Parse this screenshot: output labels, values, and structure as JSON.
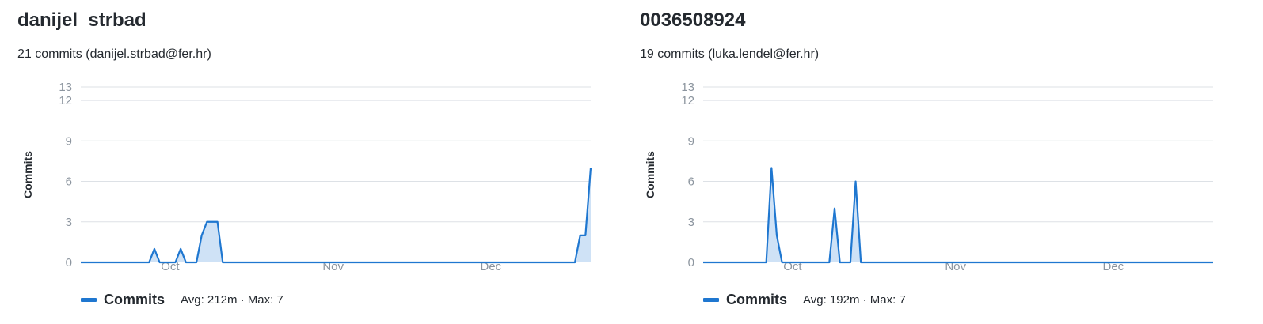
{
  "panels": [
    {
      "title": "danijel_strbad",
      "subtitle": "21 commits (danijel.strbad@fer.hr)",
      "legend_stats": "Avg: 212m · Max: 7"
    },
    {
      "title": "0036508924",
      "subtitle": "19 commits (luka.lendel@fer.hr)",
      "legend_stats": "Avg: 192m · Max: 7"
    }
  ],
  "legend_label": "Commits",
  "accent_color": "#1f77d0",
  "fill_color": "#cfe2f6",
  "chart_data": [
    {
      "type": "area",
      "title": "danijel_strbad",
      "xlabel": "",
      "ylabel": "Commits",
      "y_ticks": [
        0,
        3,
        6,
        9,
        12,
        13
      ],
      "ylim": [
        0,
        13
      ],
      "x_ticks": [
        "Oct",
        "Nov",
        "Dec"
      ],
      "grid": true,
      "legend_position": "bottom-left",
      "series": [
        {
          "name": "Commits",
          "x": [
            "2023-09-14",
            "2023-09-27",
            "2023-09-28",
            "2023-09-29",
            "2023-09-30",
            "2023-10-01",
            "2023-10-02",
            "2023-10-03",
            "2023-10-04",
            "2023-10-05",
            "2023-10-06",
            "2023-10-07",
            "2023-10-08",
            "2023-10-09",
            "2023-10-10",
            "2023-10-11",
            "2023-10-12",
            "2023-10-13",
            "2023-10-14",
            "2023-10-15",
            "2023-12-17",
            "2023-12-18",
            "2023-12-19",
            "2023-12-20"
          ],
          "values": [
            0,
            0,
            1,
            0,
            0,
            0,
            0,
            1,
            0,
            0,
            0,
            2,
            3,
            3,
            3,
            0,
            0,
            0,
            0,
            0,
            0,
            2,
            2,
            7
          ]
        }
      ]
    },
    {
      "type": "area",
      "title": "0036508924",
      "xlabel": "",
      "ylabel": "Commits",
      "y_ticks": [
        0,
        3,
        6,
        9,
        12,
        13
      ],
      "ylim": [
        0,
        13
      ],
      "x_ticks": [
        "Oct",
        "Nov",
        "Dec"
      ],
      "grid": true,
      "legend_position": "bottom-left",
      "series": [
        {
          "name": "Commits",
          "x": [
            "2023-09-14",
            "2023-09-26",
            "2023-09-27",
            "2023-09-28",
            "2023-09-29",
            "2023-10-08",
            "2023-10-09",
            "2023-10-10",
            "2023-10-11",
            "2023-10-12",
            "2023-10-13",
            "2023-10-14",
            "2023-12-20"
          ],
          "values": [
            0,
            0,
            7,
            2,
            0,
            0,
            4,
            0,
            0,
            0,
            6,
            0,
            0
          ]
        }
      ]
    }
  ]
}
